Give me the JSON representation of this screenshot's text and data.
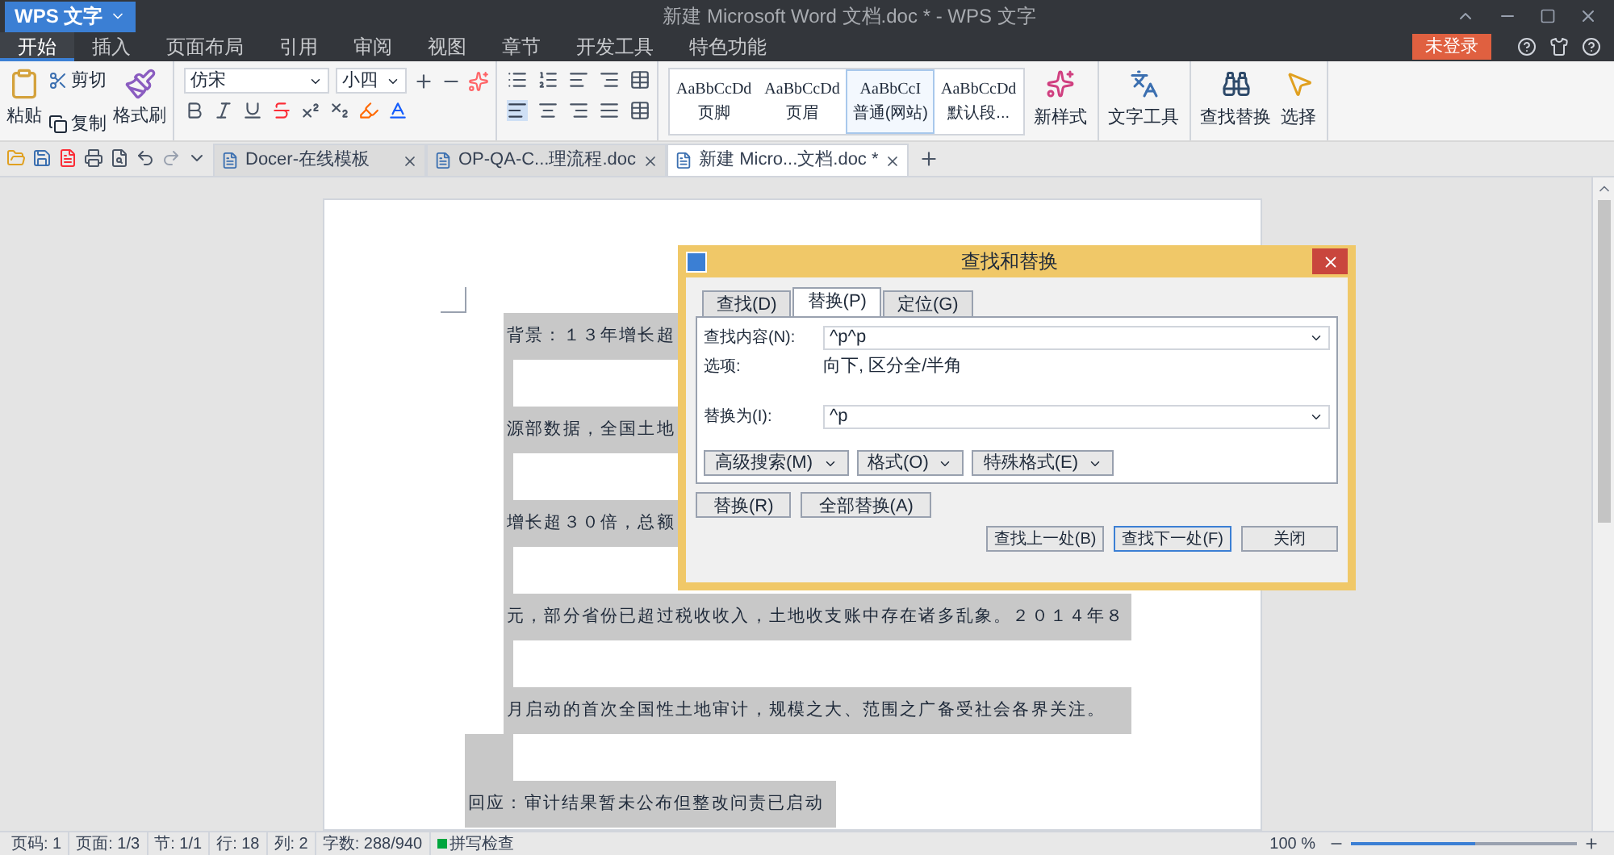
{
  "window": {
    "app_menu": "WPS 文字",
    "title": "新建 Microsoft Word 文档.doc * - WPS 文字",
    "login": "未登录"
  },
  "menu_tabs": [
    {
      "label": "开始",
      "selected": true
    },
    {
      "label": "插入",
      "selected": false
    },
    {
      "label": "页面布局",
      "selected": false
    },
    {
      "label": "引用",
      "selected": false
    },
    {
      "label": "审阅",
      "selected": false
    },
    {
      "label": "视图",
      "selected": false
    },
    {
      "label": "章节",
      "selected": false
    },
    {
      "label": "开发工具",
      "selected": false
    },
    {
      "label": "特色功能",
      "selected": false
    }
  ],
  "ribbon": {
    "paste": "粘贴",
    "cut": "剪切",
    "copy": "复制",
    "format_painter": "格式刷",
    "font": "仿宋",
    "font_size": "小四",
    "styles": [
      {
        "preview": "AaBbCcDd",
        "label": "页脚",
        "selected": false
      },
      {
        "preview": "AaBbCcDd",
        "label": "页眉",
        "selected": false
      },
      {
        "preview": "AaBbCcI",
        "label": "普通(网站)",
        "selected": true
      },
      {
        "preview": "AaBbCcDd",
        "label": "默认段...",
        "selected": false
      }
    ],
    "new_style": "新样式",
    "text_tools": "文字工具",
    "find_replace": "查找替换",
    "select": "选择"
  },
  "doc_tabs": [
    {
      "label": "Docer-在线模板",
      "selected": false
    },
    {
      "label": "OP-QA-C...理流程.doc",
      "selected": false
    },
    {
      "label": "新建 Micro...文档.doc *",
      "selected": true
    }
  ],
  "document": {
    "lines": [
      "背景：１３年增长超",
      "源部数据，全国土地",
      "增长超３０倍，总额",
      "元，部分省份已超过税收收入，土地收支账中存在诸多乱象。２０１４年８",
      "月启动的首次全国性土地审计，规模之大、范围之广备受社会各界关注。",
      "回应：审计结果暂未公布但整改问责已启动"
    ]
  },
  "dialog": {
    "title": "查找和替换",
    "tabs": [
      {
        "label": "查找(D)",
        "selected": false
      },
      {
        "label": "替换(P)",
        "selected": true
      },
      {
        "label": "定位(G)",
        "selected": false
      }
    ],
    "find_label": "查找内容(N):",
    "find_value": "^p^p",
    "options_label": "选项:",
    "options_value": "向下, 区分全/半角",
    "replace_label": "替换为(I):",
    "replace_value": "^p",
    "option_buttons": [
      "高级搜索(M)",
      "格式(O)",
      "特殊格式(E)"
    ],
    "replace_buttons": [
      "替换(R)",
      "全部替换(A)"
    ],
    "nav_buttons": [
      {
        "label": "查找上一处(B)",
        "focused": false
      },
      {
        "label": "查找下一处(F)",
        "focused": true
      },
      {
        "label": "关闭",
        "focused": false
      }
    ]
  },
  "status_bar": {
    "items": [
      "页码: 1",
      "页面: 1/3",
      "节: 1/1",
      "行: 18",
      "列: 2",
      "字数: 288/940"
    ],
    "spell_check": "拼写检查",
    "zoom": "100 %",
    "zoom_level": {
      "level": 0.55
    }
  }
}
